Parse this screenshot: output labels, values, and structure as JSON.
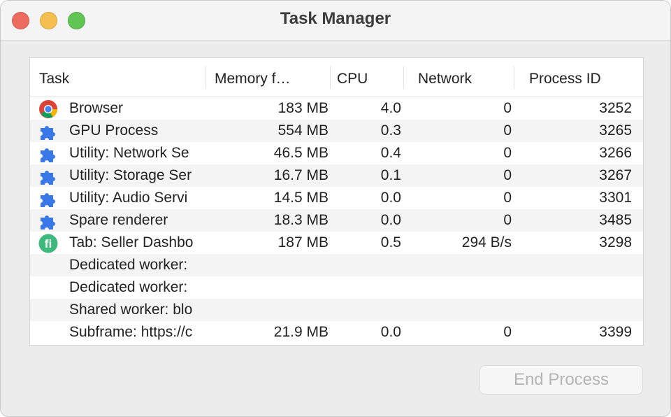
{
  "window": {
    "title": "Task Manager"
  },
  "table": {
    "columns": [
      "Task",
      "Memory f…",
      "CPU",
      "Network",
      "Process ID"
    ],
    "rows": [
      {
        "icon": "chrome-icon",
        "task": "Browser",
        "memory": "183 MB",
        "cpu": "4.0",
        "network": "0",
        "pid": "3252"
      },
      {
        "icon": "puzzle-icon",
        "task": "GPU Process",
        "memory": "554 MB",
        "cpu": "0.3",
        "network": "0",
        "pid": "3265"
      },
      {
        "icon": "puzzle-icon",
        "task": "Utility: Network Se",
        "memory": "46.5 MB",
        "cpu": "0.4",
        "network": "0",
        "pid": "3266"
      },
      {
        "icon": "puzzle-icon",
        "task": "Utility: Storage Ser",
        "memory": "16.7 MB",
        "cpu": "0.1",
        "network": "0",
        "pid": "3267"
      },
      {
        "icon": "puzzle-icon",
        "task": "Utility: Audio Servi",
        "memory": "14.5 MB",
        "cpu": "0.0",
        "network": "0",
        "pid": "3301"
      },
      {
        "icon": "puzzle-icon",
        "task": "Spare renderer",
        "memory": "18.3 MB",
        "cpu": "0.0",
        "network": "0",
        "pid": "3485"
      },
      {
        "icon": "fiverr-icon",
        "task": "Tab: Seller Dashbo",
        "memory": "187 MB",
        "cpu": "0.5",
        "network": "294 B/s",
        "pid": "3298"
      },
      {
        "icon": "",
        "task": "Dedicated worker:",
        "memory": "",
        "cpu": "",
        "network": "",
        "pid": ""
      },
      {
        "icon": "",
        "task": "Dedicated worker:",
        "memory": "",
        "cpu": "",
        "network": "",
        "pid": ""
      },
      {
        "icon": "",
        "task": "Shared worker: blo",
        "memory": "",
        "cpu": "",
        "network": "",
        "pid": ""
      },
      {
        "icon": "",
        "task": "Subframe: https://c",
        "memory": "21.9 MB",
        "cpu": "0.0",
        "network": "0",
        "pid": "3399"
      }
    ]
  },
  "actions": {
    "end_process_label": "End Process",
    "end_process_enabled": false
  },
  "colors": {
    "puzzle": "#3b78e7",
    "fiverr": "#3fb97b"
  }
}
